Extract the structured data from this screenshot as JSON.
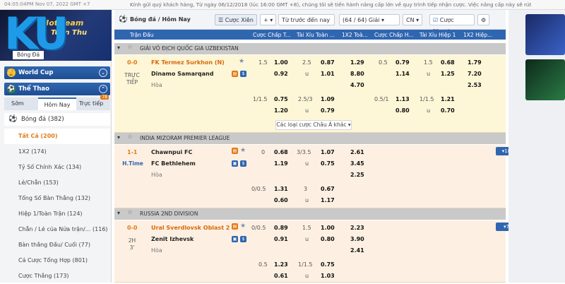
{
  "topbar": {
    "clock": "04:05:04PM Nov 07, 2022 GMT +7",
    "ticker": "Kính gửi quý khách hàng, Từ ngày 06/12/2018 (lúc 16:00 GMT +8), chúng tôi sẽ tiến hành nâng cấp lớn về quy trình tiếp nhận cược. Việc nâng cấp này sẽ rút"
  },
  "sidebar": {
    "logo": "KU",
    "promo_line1": "Hot Team",
    "promo_line2": "Tuần Thu",
    "banner_tab": "Bóng Đá",
    "world_cup": "World Cup",
    "the_thao": "Thể Thao",
    "subtabs": [
      "Sớm",
      "Hôm Nay",
      "Trực tiếp"
    ],
    "live_badge": "78",
    "sport": "Bóng đá (382)",
    "menu": [
      "Tất Cả (200)",
      "1X2 (174)",
      "Tỷ Số Chính Xác (134)",
      "Lẻ/Chẵn (153)",
      "Tổng Số Bàn Thắng (132)",
      "Hiệp 1/Toàn Trận (124)",
      "Chẵn / Lẻ của Nửa trận/... (116)",
      "Bàn thắng Đầu/ Cuối (77)",
      "Cá Cược Tổng Hợp (801)",
      "Cược Thắng (173)"
    ]
  },
  "toolbar": {
    "crumb": "Bóng đá / Hôm Nay",
    "cuoc_xien": "Cược Xiên",
    "plus": "+",
    "sort": "Từ trước đến nay",
    "count": "(64 / 64) Giải",
    "lang": "CN",
    "quick_bet": "Cược Nhanh"
  },
  "columns": [
    "Trận Đấu",
    "Cược Chấp T...",
    "Tài Xỉu Toàn ...",
    "1X2 Toà...",
    "Cược Chấp H...",
    "Tài Xỉu Hiệp 1",
    "1X2 Hiệp..."
  ],
  "leagues": [
    {
      "name": "GIẢI VÔ ĐỊCH QUỐC GIA UZBEKISTAN",
      "score": "0-0",
      "status1": "TRỰC",
      "status2": "TIẾP",
      "home": "FK Termez Surkhon (N)",
      "away": "Dinamo Samarqand",
      "draw": "Hòa",
      "more": "Các loại cược Châu Á khác",
      "rows": [
        {
          "hcap": "1.5",
          "o1": "1.00",
          "ou": "2.5",
          "o2": "0.87",
          "x12": "1.29",
          "hcap2": "0.5",
          "o3": "0.79",
          "ou2": "1.5",
          "o4": "0.68",
          "x12h": "1.79"
        },
        {
          "hcap": "",
          "o1": "0.92",
          "ou": "u",
          "o2": "1.01",
          "x12": "8.80",
          "hcap2": "",
          "o3": "1.14",
          "ou2": "u",
          "o4": "1.25",
          "x12h": "7.20"
        },
        {
          "hcap": "",
          "o1": "",
          "ou": "",
          "o2": "",
          "x12": "4.70",
          "hcap2": "",
          "o3": "",
          "ou2": "",
          "o4": "",
          "x12h": "2.53"
        },
        {
          "hcap": "1/1.5",
          "o1": "0.75",
          "ou": "2.5/3",
          "o2": "1.09",
          "x12": "",
          "hcap2": "0.5/1",
          "o3": "1.13",
          "ou2": "1/1.5",
          "o4": "1.21",
          "x12h": ""
        },
        {
          "hcap": "",
          "o1": "1.20",
          "ou": "u",
          "o2": "0.79",
          "x12": "",
          "hcap2": "",
          "o3": "0.80",
          "ou2": "u",
          "o4": "0.70",
          "x12h": ""
        }
      ]
    },
    {
      "name": "INDIA MIZORAM PREMIER LEAGUE",
      "score": "1-1",
      "status1": "H.Time",
      "status2": "",
      "home": "Chawnpui FC",
      "away": "FC Bethlehem",
      "draw": "Hòa",
      "expand": "18",
      "rows": [
        {
          "hcap": "0",
          "o1": "0.68",
          "ou": "3/3.5",
          "o2": "1.07",
          "x12": "2.61"
        },
        {
          "hcap": "",
          "o1": "1.19",
          "ou": "u",
          "o2": "0.75",
          "x12": "3.45"
        },
        {
          "hcap": "",
          "o1": "",
          "ou": "",
          "o2": "",
          "x12": "2.25"
        },
        {
          "hcap": "0/0.5",
          "o1": "1.31",
          "ou": "3",
          "o2": "0.67",
          "x12": ""
        },
        {
          "hcap": "",
          "o1": "0.60",
          "ou": "u",
          "o2": "1.17",
          "x12": ""
        }
      ]
    },
    {
      "name": "RUSSIA 2ND DIVISION",
      "score": "0-0",
      "status1": "2H",
      "status2": "3'",
      "home": "Ural Sverdlovsk Oblast 2",
      "away": "Zenit Izhevsk",
      "draw": "Hòa",
      "expand": "7",
      "rows": [
        {
          "hcap": "0/0.5",
          "o1": "0.89",
          "ou": "1.5",
          "o2": "1.00",
          "x12": "2.23"
        },
        {
          "hcap": "",
          "o1": "0.91",
          "ou": "u",
          "o2": "0.80",
          "x12": "3.90"
        },
        {
          "hcap": "",
          "o1": "",
          "ou": "",
          "o2": "",
          "x12": "2.41"
        },
        {
          "hcap": "0.5",
          "o1": "1.23",
          "ou": "1/1.5",
          "o2": "0.75",
          "x12": ""
        },
        {
          "hcap": "",
          "o1": "0.61",
          "ou": "u",
          "o2": "1.03",
          "x12": ""
        }
      ]
    }
  ],
  "icons": {
    "world_cup": "trophy-icon",
    "the_thao": "sports-icon",
    "ball": "soccer-ball-icon",
    "favorite": "star-icon"
  },
  "colors": {
    "header_blue": "#2f66b0",
    "live_orange": "#e07b1a",
    "row_yellow": "#fdf6d7",
    "row_peach": "#fdf0e2",
    "league_gray": "#c9c9c9"
  }
}
